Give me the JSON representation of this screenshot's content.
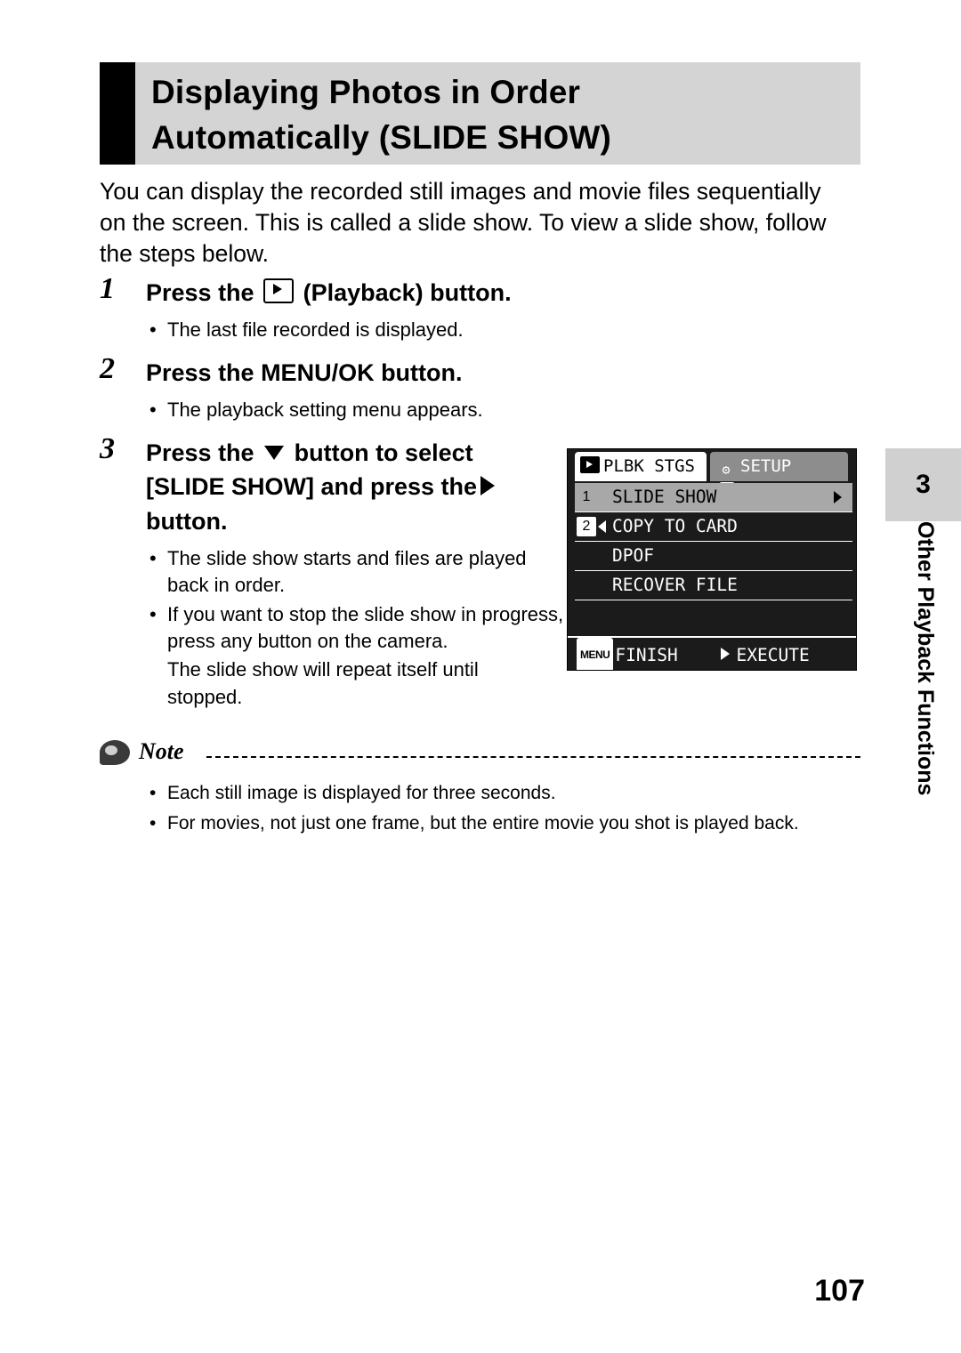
{
  "header": {
    "title_line1": "Displaying Photos in Order",
    "title_line2": "Automatically (SLIDE SHOW)"
  },
  "intro": "You can display the recorded still images and movie files sequentially on the screen. This is called a slide show. To view a slide show, follow the steps below.",
  "steps": [
    {
      "number": "1",
      "title_pre": "Press the",
      "title_post": "(Playback) button.",
      "icon": "playback-icon",
      "bullets": [
        "The last file recorded is displayed."
      ]
    },
    {
      "number": "2",
      "title": "Press the MENU/OK button.",
      "bullets": [
        "The playback setting menu appears."
      ]
    },
    {
      "number": "3",
      "title_part1": "Press the",
      "title_part2": "button to select",
      "title_part3": "[SLIDE SHOW] and press the",
      "title_part4": "button.",
      "icon_down": "triangle-down-icon",
      "icon_right": "triangle-right-icon",
      "bullets": [
        "The slide show starts and files are played back in order.",
        "If you want to stop the slide show in progress, press any button on the camera."
      ],
      "extra_line1": "The slide show will repeat itself until",
      "extra_line2": "stopped."
    }
  ],
  "lcd": {
    "tab_active": "PLBK STGS",
    "tab_inactive": "SETUP",
    "rows": [
      {
        "badge": "1",
        "badge_boxed": false,
        "left_arrow": false,
        "label": "SLIDE SHOW",
        "right_arrow": true,
        "selected": true
      },
      {
        "badge": "2",
        "badge_boxed": true,
        "left_arrow": true,
        "label": "COPY TO CARD",
        "right_arrow": false,
        "selected": false
      },
      {
        "badge": "",
        "badge_boxed": false,
        "left_arrow": false,
        "label": "DPOF",
        "right_arrow": false,
        "selected": false
      },
      {
        "badge": "",
        "badge_boxed": false,
        "left_arrow": false,
        "label": "RECOVER FILE",
        "right_arrow": false,
        "selected": false
      },
      {
        "badge": "",
        "badge_boxed": false,
        "left_arrow": false,
        "label": "",
        "right_arrow": false,
        "selected": false
      }
    ],
    "footer_menu_badge": "MENU",
    "footer_finish": "FINISH",
    "footer_execute": "EXECUTE"
  },
  "note": {
    "label": "Note",
    "items": [
      "Each still image is displayed for three seconds.",
      "For movies, not just one frame, but the entire movie you shot is played back."
    ]
  },
  "side": {
    "chapter_number": "3",
    "chapter_title": "Other Playback Functions"
  },
  "page_number": "107"
}
